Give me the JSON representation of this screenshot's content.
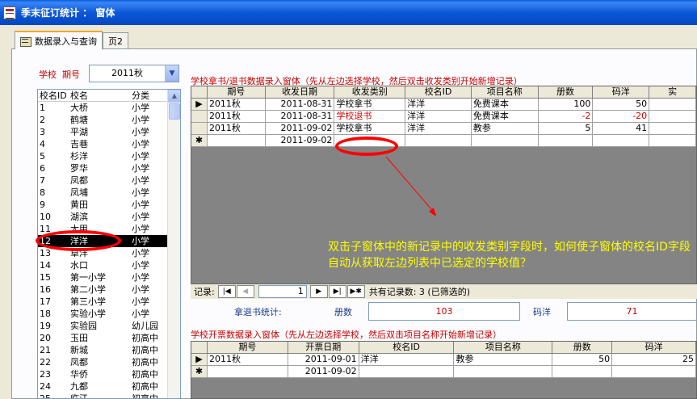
{
  "window": {
    "title": "季末征订统计 ： 窗体"
  },
  "tabs": [
    {
      "label": "数据录入与查询"
    },
    {
      "label": "页2"
    }
  ],
  "filters": {
    "school_label": "学校",
    "period_label": "期号",
    "period_value": "2011秋"
  },
  "school_list": {
    "headers": [
      "校名ID",
      "校名",
      "分类"
    ],
    "rows": [
      {
        "id": "1",
        "name": "大桥",
        "type": "小学"
      },
      {
        "id": "2",
        "name": "鹤塘",
        "type": "小学"
      },
      {
        "id": "3",
        "name": "平湖",
        "type": "小学"
      },
      {
        "id": "4",
        "name": "吉巷",
        "type": "小学"
      },
      {
        "id": "5",
        "name": "杉洋",
        "type": "小学"
      },
      {
        "id": "6",
        "name": "罗华",
        "type": "小学"
      },
      {
        "id": "7",
        "name": "凤都",
        "type": "小学"
      },
      {
        "id": "8",
        "name": "凤埔",
        "type": "小学"
      },
      {
        "id": "9",
        "name": "黄田",
        "type": "小学"
      },
      {
        "id": "10",
        "name": "湖滨",
        "type": "小学"
      },
      {
        "id": "11",
        "name": "大甲",
        "type": "小学"
      },
      {
        "id": "12",
        "name": "洋洋",
        "type": "小学"
      },
      {
        "id": "13",
        "name": "卓洋",
        "type": "小学"
      },
      {
        "id": "14",
        "name": "水口",
        "type": "小学"
      },
      {
        "id": "15",
        "name": "第一小学",
        "type": "小学"
      },
      {
        "id": "16",
        "name": "第二小学",
        "type": "小学"
      },
      {
        "id": "17",
        "name": "第三小学",
        "type": "小学"
      },
      {
        "id": "18",
        "name": "实验小学",
        "type": "小学"
      },
      {
        "id": "19",
        "name": "实验园",
        "type": "幼儿园"
      },
      {
        "id": "20",
        "name": "玉田",
        "type": "初高中"
      },
      {
        "id": "21",
        "name": "新城",
        "type": "初高中"
      },
      {
        "id": "22",
        "name": "凤都",
        "type": "初高中"
      },
      {
        "id": "23",
        "name": "华侨",
        "type": "初高中"
      },
      {
        "id": "24",
        "name": "九都",
        "type": "初高中"
      },
      {
        "id": "25",
        "name": "临江",
        "type": "初高中"
      }
    ]
  },
  "book_form": {
    "caption": "学校拿书/退书数据录入窗体（先从左边选择学校，然后双击收发类别开始新增记录）",
    "headers": [
      "期号",
      "收发日期",
      "收发类别",
      "校名ID",
      "项目名称",
      "册数",
      "码洋",
      "实"
    ],
    "rows": [
      {
        "marker": "▶",
        "period": "2011秋",
        "date": "2011-08-31",
        "category": "学校拿书",
        "school": "洋洋",
        "project": "免费课本",
        "count": "100",
        "amount": "50",
        "red": false
      },
      {
        "marker": "",
        "period": "2011秋",
        "date": "2011-08-31",
        "category": "学校退书",
        "school": "洋洋",
        "project": "免费课本",
        "count": "-2",
        "amount": "-20",
        "red": true
      },
      {
        "marker": "",
        "period": "2011秋",
        "date": "2011-09-02",
        "category": "学校拿书",
        "school": "洋洋",
        "project": "教参",
        "count": "5",
        "amount": "41",
        "red": false
      },
      {
        "marker": "✱",
        "period": "",
        "date": "2011-09-02",
        "category": "",
        "school": "",
        "project": "",
        "count": "",
        "amount": "",
        "red": false
      }
    ],
    "nav": {
      "label": "记录:",
      "current": "1",
      "status": "共有记录数: 3 (已筛选的)"
    }
  },
  "stats": {
    "label": "拿退书统计:",
    "count_label": "册数",
    "count_value": "103",
    "amount_label": "码洋",
    "amount_value": "71"
  },
  "invoice_form": {
    "caption": "学校开票数据录入窗体（先从左边选择学校，然后双击项目名称开始新增记录）",
    "headers": [
      "期号",
      "开票日期",
      "校名ID",
      "项目名称",
      "册数",
      "码洋"
    ],
    "rows": [
      {
        "marker": "▶",
        "period": "2011秋",
        "date": "2011-09-01",
        "school": "洋洋",
        "project": "教参",
        "count": "50",
        "amount": "25"
      },
      {
        "marker": "✱",
        "period": "",
        "date": "2011-09-02",
        "school": "",
        "project": "",
        "count": "",
        "amount": ""
      }
    ]
  },
  "annotation": {
    "text": "双击子窗体中的新记录中的收发类别字段时，如何使子窗体的校名ID字段自动从获取左边列表中已选定的学校值？"
  },
  "colors": {
    "titlebar": "#0b58d8",
    "subform_bg": "#848484",
    "highlight_red": "#ff0000",
    "annotation_yellow": "#ffff00",
    "caption_red": "#c80000"
  }
}
